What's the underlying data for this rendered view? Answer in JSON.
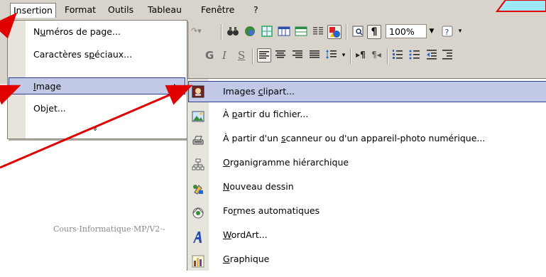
{
  "menubar": {
    "items": [
      {
        "label": "Insertion",
        "active": true
      },
      {
        "label": "Format"
      },
      {
        "label": "Outils"
      },
      {
        "label": "Tableau"
      },
      {
        "label": "Fenêtre"
      },
      {
        "label": "?"
      }
    ]
  },
  "toolbar": {
    "zoom": "100%"
  },
  "insert_menu": {
    "items": [
      {
        "label": "Numéros de page..."
      },
      {
        "label": "Caractères spéciaux..."
      },
      {
        "label": "Image",
        "highlighted": true,
        "has_submenu": true
      },
      {
        "label": "Objet..."
      }
    ],
    "more": "»"
  },
  "image_submenu": {
    "items": [
      {
        "label": "Images clipart...",
        "icon": "clipart-icon",
        "highlighted": true
      },
      {
        "label": "À partir du fichier...",
        "icon": "picture-file-icon"
      },
      {
        "label": "À partir d'un scanneur ou d'un appareil-photo numérique...",
        "icon": "scanner-icon"
      },
      {
        "label": "Organigramme hiérarchique",
        "icon": "org-chart-icon"
      },
      {
        "label": "Nouveau dessin",
        "icon": "new-drawing-icon"
      },
      {
        "label": "Formes automatiques",
        "icon": "autoshapes-icon"
      },
      {
        "label": "WordArt...",
        "icon": "wordart-icon"
      },
      {
        "label": "Graphique",
        "icon": "chart-icon"
      }
    ]
  },
  "document": {
    "footer_text": "Cours·Informatique·MP/V2·-"
  },
  "colors": {
    "chrome": "#d8d4cc",
    "menu_highlight": "#c1c9e6",
    "menu_highlight_border": "#2c3c8c",
    "annotation_arrow": "#e00000"
  }
}
